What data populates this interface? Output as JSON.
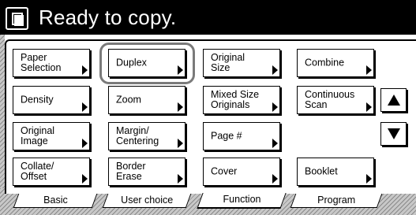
{
  "header": {
    "title": "Ready to copy."
  },
  "buttons": {
    "paper_selection": "Paper\nSelection",
    "duplex": "Duplex",
    "original_size": "Original\nSize",
    "combine": "Combine",
    "density": "Density",
    "zoom": "Zoom",
    "mixed_size_originals": "Mixed Size\nOriginals",
    "continuous_scan": "Continuous\nScan",
    "original_image": "Original\nImage",
    "margin_centering": "Margin/\nCentering",
    "page_number": "Page #",
    "collate_offset": "Collate/\nOffset",
    "border_erase": "Border\nErase",
    "cover": "Cover",
    "booklet": "Booklet"
  },
  "tabs": [
    {
      "label": "Basic"
    },
    {
      "label": "User choice"
    },
    {
      "label": "Function"
    },
    {
      "label": "Program"
    }
  ],
  "active_tab": "Function",
  "highlighted_button": "Duplex"
}
